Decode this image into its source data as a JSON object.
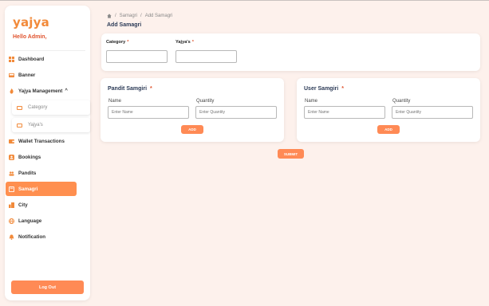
{
  "app": {
    "logo": "yajya",
    "greeting": "Hello Admin,"
  },
  "sidebar": {
    "items": [
      {
        "label": "Dashboard",
        "icon": "dashboard-icon"
      },
      {
        "label": "Banner",
        "icon": "banner-icon"
      },
      {
        "label": "Yajya Management",
        "icon": "flame-icon",
        "expanded": true
      },
      {
        "label": "Wallet Transactions",
        "icon": "wallet-icon"
      },
      {
        "label": "Bookings",
        "icon": "bookings-icon"
      },
      {
        "label": "Pandits",
        "icon": "people-icon"
      },
      {
        "label": "Samagri",
        "icon": "samagri-icon",
        "active": true
      },
      {
        "label": "City",
        "icon": "city-icon"
      },
      {
        "label": "Language",
        "icon": "globe-icon"
      },
      {
        "label": "Notification",
        "icon": "bell-icon"
      }
    ],
    "sub_items": [
      {
        "label": "Category",
        "icon": "tag-icon"
      },
      {
        "label": "Yajya's",
        "icon": "tag-icon"
      }
    ],
    "logout_label": "Log Out"
  },
  "breadcrumb": {
    "home_icon": "home-icon",
    "sep": "/",
    "items": [
      "Samagri",
      "Add Samagri"
    ]
  },
  "page_title": "Add Samagri",
  "filters": {
    "category_label": "Category",
    "yajya_label": "Yajya's",
    "category_value": "",
    "yajya_value": ""
  },
  "pandit_card": {
    "title": "Pandit Samgiri",
    "name_label": "Name",
    "quantity_label": "Quantity",
    "name_placeholder": "Enter Name",
    "quantity_placeholder": "Enter Quantity",
    "add_label": "ADD"
  },
  "user_card": {
    "title": "User Samgiri",
    "name_label": "Name",
    "quantity_label": "Quantity",
    "name_placeholder": "Enter Name",
    "quantity_placeholder": "Enter Quantity",
    "add_label": "ADD"
  },
  "submit_label": "SUBMIT",
  "colors": {
    "accent": "#ff8a55",
    "danger": "#e0542f",
    "title": "#2b3a56",
    "background": "#fdf1ec"
  }
}
